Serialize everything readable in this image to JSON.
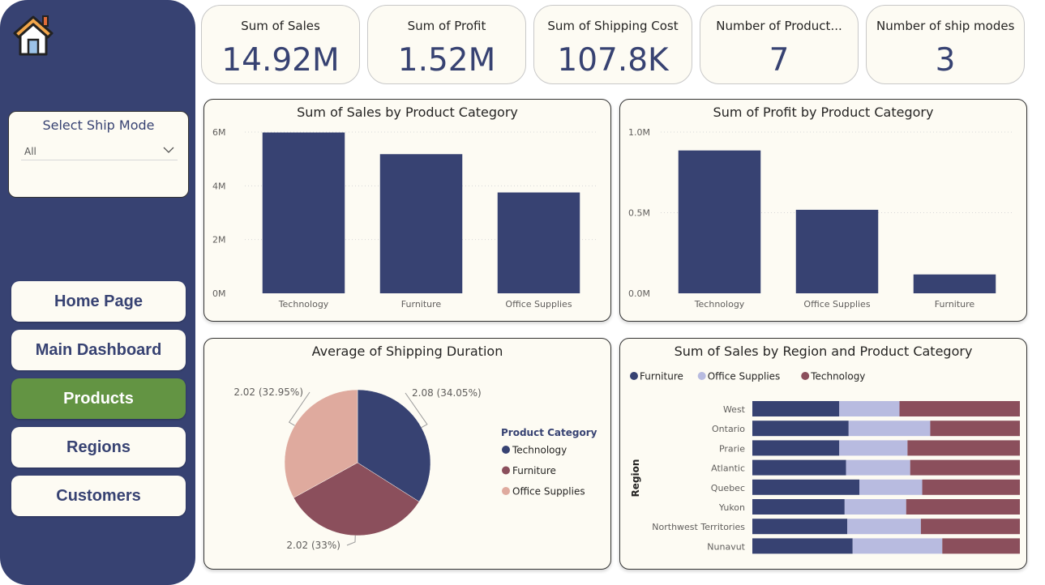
{
  "sidebar": {
    "home_icon": "home-icon",
    "slicer": {
      "title": "Select Ship Mode",
      "selected": "All",
      "icon": "chevron-down-icon"
    },
    "nav": [
      {
        "label": "Home Page",
        "active": false
      },
      {
        "label": "Main Dashboard",
        "active": false
      },
      {
        "label": "Products",
        "active": true
      },
      {
        "label": "Regions",
        "active": false
      },
      {
        "label": "Customers",
        "active": false
      }
    ]
  },
  "kpis": [
    {
      "label": "Sum of Sales",
      "value": "14.92M"
    },
    {
      "label": "Sum of Profit",
      "value": "1.52M"
    },
    {
      "label": "Sum of Shipping Cost",
      "value": "107.8K"
    },
    {
      "label": "Number of Product...",
      "value": "7"
    },
    {
      "label": "Number of ship modes",
      "value": "3"
    }
  ],
  "colors": {
    "navy": "#374272",
    "maroon": "#8b4f5c",
    "lavender": "#b8bbe0",
    "peach": "#dfaa9e",
    "active_green": "#639443",
    "card_bg": "#fdfbf3"
  },
  "chart_data": [
    {
      "id": "sales_by_category",
      "type": "bar",
      "title": "Sum of Sales by Product Category",
      "categories": [
        "Technology",
        "Furniture",
        "Office Supplies"
      ],
      "values": [
        5984248,
        5178591,
        3752762
      ],
      "y_ticks": [
        0,
        2000000,
        4000000,
        6000000
      ],
      "y_tick_labels": [
        "0M",
        "2M",
        "4M",
        "6M"
      ],
      "ylim": [
        0,
        6000000
      ],
      "grid": true
    },
    {
      "id": "profit_by_category",
      "type": "bar",
      "title": "Sum of Profit by Product Category",
      "categories": [
        "Technology",
        "Office Supplies",
        "Furniture"
      ],
      "values": [
        886000,
        518000,
        117000
      ],
      "y_ticks": [
        0,
        500000,
        1000000
      ],
      "y_tick_labels": [
        "0.0M",
        "0.5M",
        "1.0M"
      ],
      "ylim": [
        0,
        1000000
      ],
      "grid": true
    },
    {
      "id": "shipping_duration",
      "type": "pie",
      "title": "Average of Shipping Duration",
      "legend_title": "Product Category",
      "legend_position": "right",
      "slices": [
        {
          "label": "Technology",
          "value": 2.08,
          "display": "2.08 (34.05%)",
          "color": "#374272"
        },
        {
          "label": "Furniture",
          "value": 2.02,
          "display": "2.02 (33%)",
          "color": "#8b4f5c"
        },
        {
          "label": "Office Supplies",
          "value": 2.02,
          "display": "2.02 (32.95%)",
          "color": "#dfaa9e"
        }
      ]
    },
    {
      "id": "sales_by_region",
      "type": "bar",
      "orientation": "horizontal",
      "stacked": "100%",
      "title": "Sum of Sales by Region and Product Category",
      "ylabel": "Region",
      "legend_position": "top-left",
      "categories": [
        "West",
        "Ontario",
        "Prarie",
        "Atlantic",
        "Quebec",
        "Yukon",
        "Northwest Territories",
        "Nunavut"
      ],
      "series": [
        {
          "name": "Furniture",
          "color": "#374272",
          "values": [
            32.5,
            36,
            32.5,
            35,
            40,
            34.5,
            35.5,
            37.5
          ]
        },
        {
          "name": "Office Supplies",
          "color": "#b8bbe0",
          "values": [
            22.5,
            30.5,
            25.5,
            24,
            23.5,
            23,
            27.5,
            33.5
          ]
        },
        {
          "name": "Technology",
          "color": "#8b4f5c",
          "values": [
            45,
            33.5,
            42,
            41,
            36.5,
            42.5,
            37,
            29
          ]
        }
      ]
    }
  ]
}
